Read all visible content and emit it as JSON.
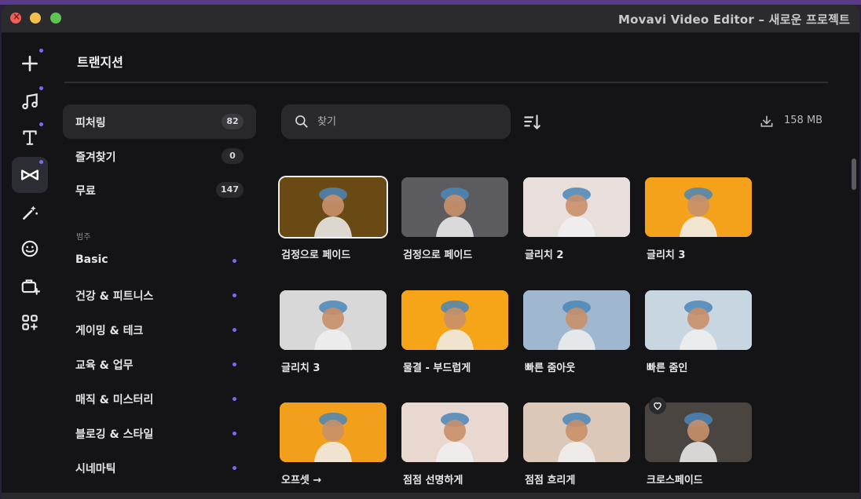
{
  "window": {
    "title": "Movavi Video Editor – 새로운 프로젝트"
  },
  "rail": {
    "items": [
      "add",
      "music",
      "titles",
      "transitions",
      "filters",
      "stickers",
      "stock",
      "more"
    ]
  },
  "panel": {
    "title": "트랜지션"
  },
  "categories": [
    {
      "label": "피처링",
      "count": "82"
    },
    {
      "label": "즐겨찾기",
      "count": "0"
    },
    {
      "label": "무료",
      "count": "147"
    }
  ],
  "section_label": "범주",
  "subcategories": [
    "Basic",
    "건강 & 피트니스",
    "게이밍 & 테크",
    "교육 & 업무",
    "매직 & 미스터리",
    "블로깅 & 스타일",
    "시네마틱"
  ],
  "search": {
    "placeholder": "찾기",
    "value": ""
  },
  "download": {
    "size": "158 MB"
  },
  "tiles": [
    {
      "label": "검정으로 페이드",
      "bg": "#6a4a14"
    },
    {
      "label": "검정으로 페이드",
      "bg": "#5c5c60"
    },
    {
      "label": "글리치 2",
      "bg": "#e8dedc"
    },
    {
      "label": "글리치 3",
      "bg": "#f4a21c"
    },
    {
      "label": "글리치 3",
      "bg": "#d8d8d8"
    },
    {
      "label": "물결 - 부드럽게",
      "bg": "#f6a418"
    },
    {
      "label": "빠른 줌아웃",
      "bg": "#9fb8d0"
    },
    {
      "label": "빠른 줌인",
      "bg": "#c8d6e2"
    },
    {
      "label": "오프셋 →",
      "bg": "#f2a01c"
    },
    {
      "label": "점점 선명하게",
      "bg": "#e8d8d0"
    },
    {
      "label": "점점 흐리게",
      "bg": "#dcc8b8"
    },
    {
      "label": "크로스페이드",
      "bg": "#4a4540"
    }
  ],
  "colors": {
    "accent": "#7a6cf0",
    "background": "#141416",
    "panel": "#28282c"
  }
}
